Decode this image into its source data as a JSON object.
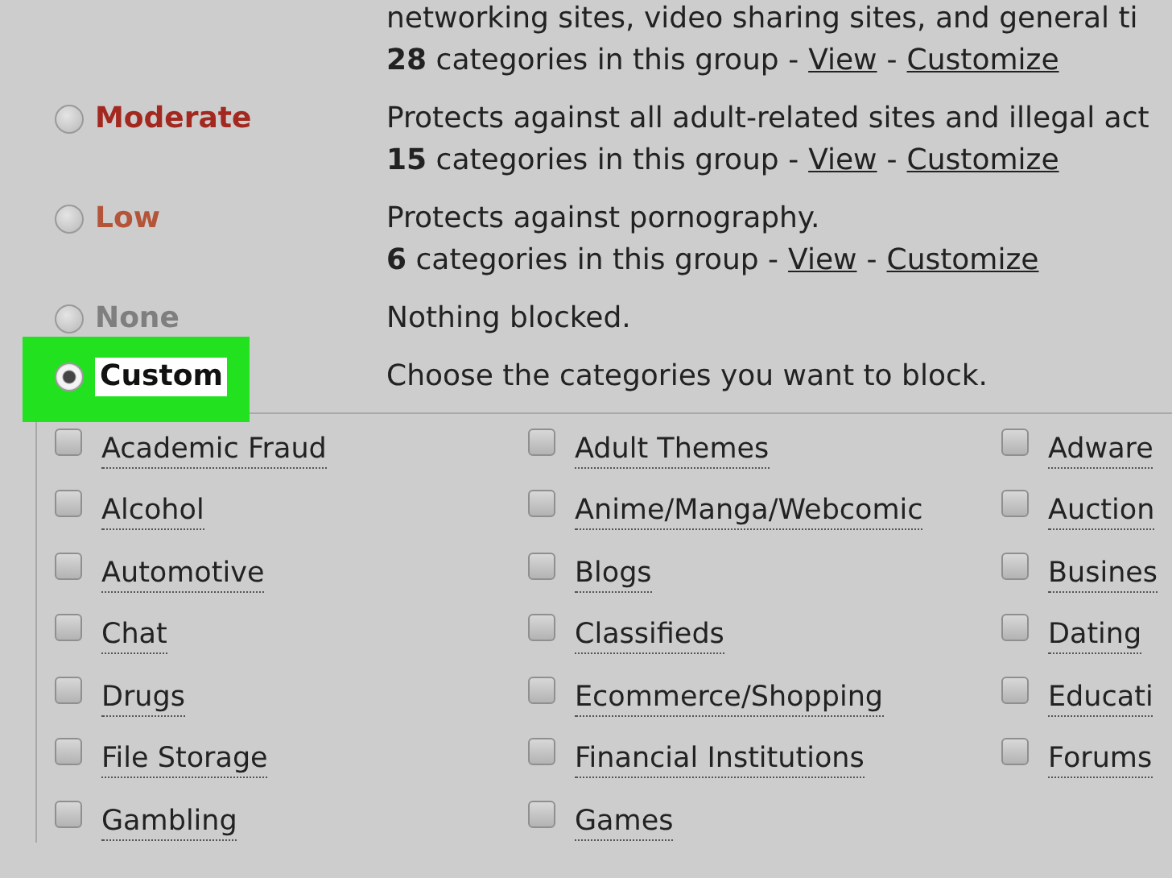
{
  "levels": [
    {
      "description": "networking sites, video sharing sites, and general ti",
      "count": "28",
      "count_suffix": "categories in this group -",
      "view": "View",
      "separator": "-",
      "customize": "Customize"
    },
    {
      "name": "Moderate",
      "color": "#a3281f",
      "selected": false,
      "description": "Protects against all adult-related sites and illegal act",
      "count": "15",
      "count_suffix": "categories in this group -",
      "view": "View",
      "separator": "-",
      "customize": "Customize"
    },
    {
      "name": "Low",
      "color": "#b4553a",
      "selected": false,
      "description": "Protects against pornography.",
      "count": "6",
      "count_suffix": "categories in this group -",
      "view": "View",
      "separator": "-",
      "customize": "Customize"
    },
    {
      "name": "None",
      "color": "#7f7f7f",
      "selected": false,
      "description": "Nothing blocked."
    },
    {
      "name": "Custom",
      "color": "#111111",
      "selected": true,
      "highlighted": true,
      "description": "Choose the categories you want to block."
    }
  ],
  "categories": [
    [
      {
        "label": "Academic Fraud",
        "checked": false
      },
      {
        "label": "Adult Themes",
        "checked": false
      },
      {
        "label": "Adware",
        "checked": false
      }
    ],
    [
      {
        "label": "Alcohol",
        "checked": false
      },
      {
        "label": "Anime/Manga/Webcomic",
        "checked": false
      },
      {
        "label": "Auction",
        "checked": false
      }
    ],
    [
      {
        "label": "Automotive",
        "checked": false
      },
      {
        "label": "Blogs",
        "checked": false
      },
      {
        "label": "Busines",
        "checked": false
      }
    ],
    [
      {
        "label": "Chat",
        "checked": false
      },
      {
        "label": "Classifieds",
        "checked": false
      },
      {
        "label": "Dating",
        "checked": false
      }
    ],
    [
      {
        "label": "Drugs",
        "checked": false
      },
      {
        "label": "Ecommerce/Shopping",
        "checked": false
      },
      {
        "label": "Educati",
        "checked": false
      }
    ],
    [
      {
        "label": "File Storage",
        "checked": false
      },
      {
        "label": "Financial Institutions",
        "checked": false
      },
      {
        "label": "Forums",
        "checked": false
      }
    ],
    [
      {
        "label": "Gambling",
        "checked": false
      },
      {
        "label": "Games",
        "checked": false
      }
    ]
  ]
}
